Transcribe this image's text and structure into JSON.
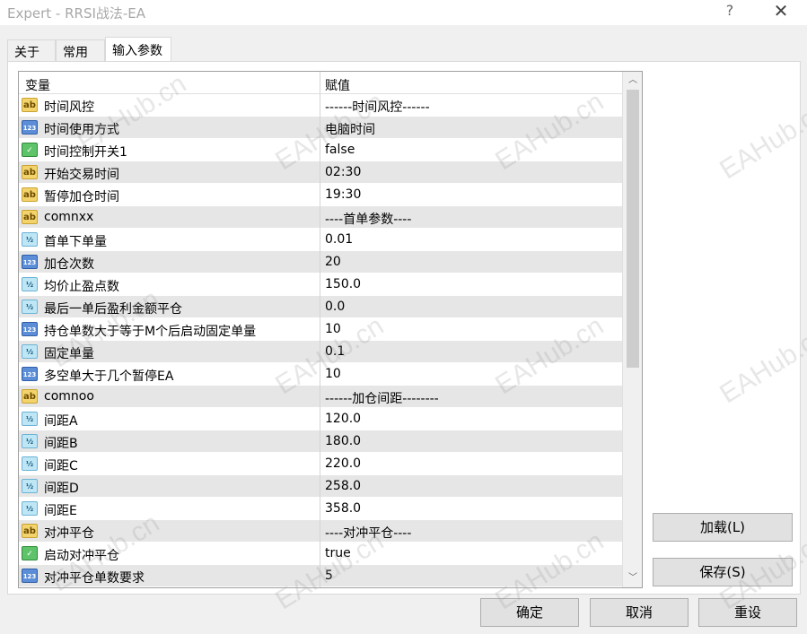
{
  "window": {
    "title": "Expert - RRSI战法-EA",
    "help_glyph": "?",
    "close_glyph": "✕"
  },
  "tabs": [
    {
      "label": "关于"
    },
    {
      "label": "常用"
    },
    {
      "label": "输入参数"
    }
  ],
  "grid": {
    "col_name": "变量",
    "col_value": "赋值",
    "rows": [
      {
        "icon": "ab",
        "name": "时间风控",
        "value": "------时间风控------"
      },
      {
        "icon": "123",
        "name": "时间使用方式",
        "value": "电脑时间"
      },
      {
        "icon": "bool",
        "name": "时间控制开关1",
        "value": "false"
      },
      {
        "icon": "ab",
        "name": "开始交易时间",
        "value": "02:30"
      },
      {
        "icon": "ab",
        "name": "暂停加仓时间",
        "value": "19:30"
      },
      {
        "icon": "ab",
        "name": "comnxx",
        "value": "----首单参数----"
      },
      {
        "icon": "half",
        "name": "首单下单量",
        "value": "0.01"
      },
      {
        "icon": "123",
        "name": "加仓次数",
        "value": "20"
      },
      {
        "icon": "half",
        "name": "均价止盈点数",
        "value": "150.0"
      },
      {
        "icon": "half",
        "name": "最后一单后盈利金额平仓",
        "value": "0.0"
      },
      {
        "icon": "123",
        "name": "持仓单数大于等于M个后启动固定单量",
        "value": "10"
      },
      {
        "icon": "half",
        "name": "固定单量",
        "value": "0.1"
      },
      {
        "icon": "123",
        "name": "多空单大于几个暂停EA",
        "value": "10"
      },
      {
        "icon": "ab",
        "name": "comnoo",
        "value": "------加仓间距--------"
      },
      {
        "icon": "half",
        "name": "间距A",
        "value": "120.0"
      },
      {
        "icon": "half",
        "name": "间距B",
        "value": "180.0"
      },
      {
        "icon": "half",
        "name": "间距C",
        "value": "220.0"
      },
      {
        "icon": "half",
        "name": "间距D",
        "value": "258.0"
      },
      {
        "icon": "half",
        "name": "间距E",
        "value": "358.0"
      },
      {
        "icon": "ab",
        "name": "对冲平仓",
        "value": "----对冲平仓----"
      },
      {
        "icon": "bool",
        "name": "启动对冲平仓",
        "value": "true"
      },
      {
        "icon": "123",
        "name": "对冲平仓单数要求",
        "value": "5"
      }
    ],
    "scroll_up_glyph": "︿",
    "scroll_down_glyph": "﹀"
  },
  "icons": {
    "ab": {
      "glyph": "ab",
      "semantic": "string-type-icon"
    },
    "123": {
      "glyph": "123",
      "semantic": "integer-type-icon"
    },
    "half": {
      "glyph": "½",
      "semantic": "double-type-icon"
    },
    "bool": {
      "glyph": "✓",
      "semantic": "bool-type-icon"
    }
  },
  "buttons": {
    "load": "加载(L)",
    "save": "保存(S)",
    "ok": "确定",
    "cancel": "取消",
    "reset": "重设"
  },
  "watermark": "EAHub.cn"
}
